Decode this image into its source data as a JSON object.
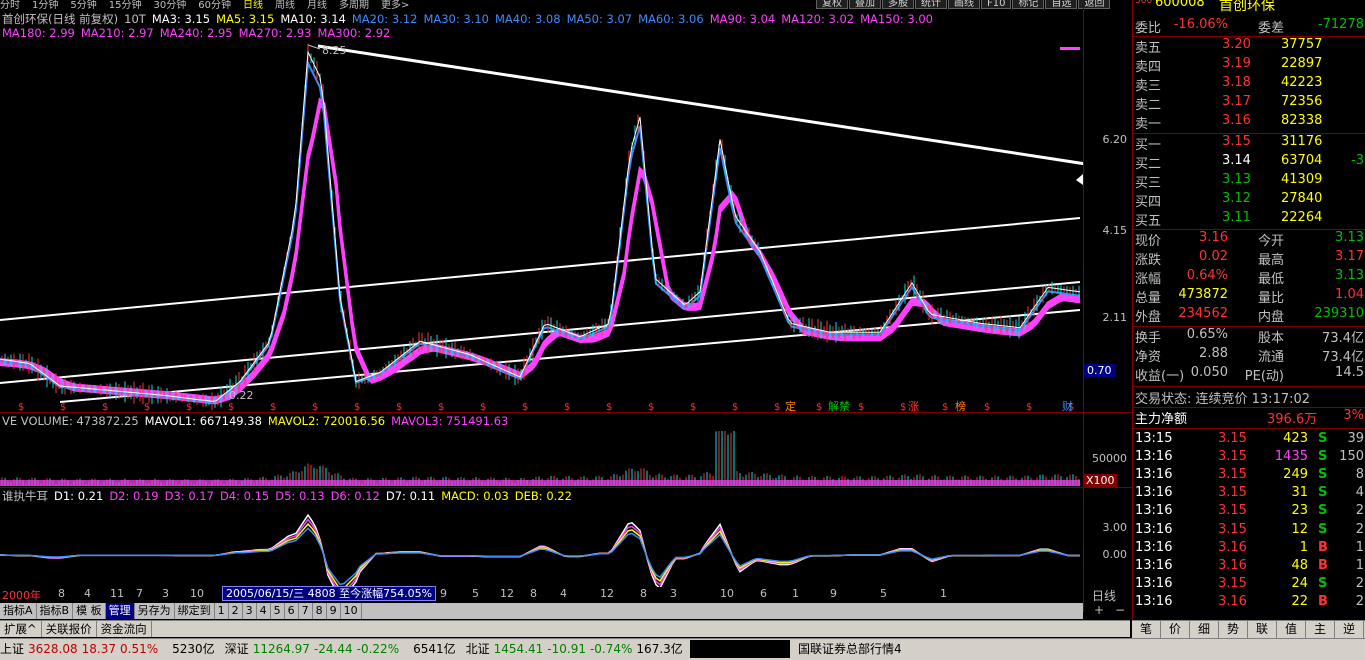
{
  "top_menu": [
    "分时",
    "1分钟",
    "5分钟",
    "15分钟",
    "30分钟",
    "60分钟",
    "日线",
    "周线",
    "月线",
    "多周期",
    "更多>"
  ],
  "top_buttons": [
    "复权",
    "叠加",
    "多股",
    "统计",
    "画线",
    "F10",
    "标记",
    "自选",
    "返回"
  ],
  "stock_header": {
    "code": "600008",
    "name": "首创环保",
    "flag": "500"
  },
  "chart_title": "首创环保(日线 前复权)",
  "ma_line1": [
    {
      "label": "10T",
      "color": "#c0c0c0"
    },
    {
      "label": "MA3: 3.15",
      "color": "#ffffff"
    },
    {
      "label": "MA5: 3.15",
      "color": "#ffff00"
    },
    {
      "label": "MA10: 3.14",
      "color": "#ffffff"
    },
    {
      "label": "MA20: 3.12",
      "color": "#3c8cff"
    },
    {
      "label": "MA30: 3.10",
      "color": "#3c8cff"
    },
    {
      "label": "MA40: 3.08",
      "color": "#3c8cff"
    },
    {
      "label": "MA50: 3.07",
      "color": "#3c8cff"
    },
    {
      "label": "MA60: 3.06",
      "color": "#3c8cff"
    },
    {
      "label": "MA90: 3.04",
      "color": "#ff40ff"
    },
    {
      "label": "MA120: 3.02",
      "color": "#ff40ff"
    },
    {
      "label": "MA150: 3.00",
      "color": "#ff40ff"
    }
  ],
  "ma_line2": [
    {
      "label": "MA180: 2.99",
      "color": "#ff40ff"
    },
    {
      "label": "MA210: 2.97",
      "color": "#ff40ff"
    },
    {
      "label": "MA240: 2.95",
      "color": "#ff40ff"
    },
    {
      "label": "MA270: 2.93",
      "color": "#ff40ff"
    },
    {
      "label": "MA300: 2.92",
      "color": "#ff40ff"
    }
  ],
  "price_axis": [
    "8.25",
    "6.20",
    "4.15",
    "2.11",
    "0.70"
  ],
  "high_marker": "8.25",
  "low_marker": "0.22",
  "event_tags": [
    "定",
    "解禁",
    "涨",
    "榜",
    "财"
  ],
  "volume_line": [
    {
      "label": "VE VOLUME: 473872.25",
      "color": "#c0c0c0"
    },
    {
      "label": "MAVOL1: 667149.38",
      "color": "#ffffff"
    },
    {
      "label": "MAVOL2: 720016.56",
      "color": "#ffff00"
    },
    {
      "label": "MAVOL3: 751491.63",
      "color": "#ff40ff"
    }
  ],
  "volume_axis": [
    "50000",
    "X100"
  ],
  "indicator_line": [
    {
      "label": "谁执牛耳",
      "color": "#c0c0c0"
    },
    {
      "label": "D1: 0.21",
      "color": "#ffffff"
    },
    {
      "label": "D2: 0.19",
      "color": "#ff40ff"
    },
    {
      "label": "D3: 0.17",
      "color": "#ff40ff"
    },
    {
      "label": "D4: 0.15",
      "color": "#ff40ff"
    },
    {
      "label": "D5: 0.13",
      "color": "#ff40ff"
    },
    {
      "label": "D6: 0.12",
      "color": "#ff40ff"
    },
    {
      "label": "D7: 0.11",
      "color": "#ffffff"
    },
    {
      "label": "MACD: 0.03",
      "color": "#ffff00"
    },
    {
      "label": "DEB: 0.22",
      "color": "#ffff00"
    }
  ],
  "indicator_axis": [
    "3.00",
    "0.00"
  ],
  "date_axis": {
    "start": "2000年",
    "ticks": [
      "8",
      "4",
      "11",
      "7",
      "3",
      "10",
      "9",
      "5",
      "12",
      "8",
      "4",
      "12",
      "8",
      "3",
      "10",
      "6",
      "1",
      "9",
      "5",
      "1"
    ],
    "highlight": "2005/06/15/三 4808 至今涨幅754.05%",
    "right_label": "日线",
    "plus": "+",
    "minus": "−"
  },
  "indicator_tabs": [
    "指标A",
    "指标B",
    "模 板",
    "管理",
    "另存为",
    "绑定到",
    "1",
    "2",
    "3",
    "4",
    "5",
    "6",
    "7",
    "8",
    "9",
    "10"
  ],
  "selected_tab": "管理",
  "bottom_tabs": [
    "扩展^",
    "关联报价",
    "资金流向"
  ],
  "order_book": {
    "ratio_label": "委比",
    "ratio": "-16.06%",
    "diff_label": "委差",
    "diff": "-71278",
    "asks": [
      {
        "label": "卖五",
        "price": "3.20",
        "vol": "37757"
      },
      {
        "label": "卖四",
        "price": "3.19",
        "vol": "22897"
      },
      {
        "label": "卖三",
        "price": "3.18",
        "vol": "42223"
      },
      {
        "label": "卖二",
        "price": "3.17",
        "vol": "72356"
      },
      {
        "label": "卖一",
        "price": "3.16",
        "vol": "82338"
      }
    ],
    "bids": [
      {
        "label": "买一",
        "price": "3.15",
        "vol": "31176",
        "extra": ""
      },
      {
        "label": "买二",
        "price": "3.14",
        "vol": "63704",
        "extra": "-3"
      },
      {
        "label": "买三",
        "price": "3.13",
        "vol": "41309",
        "extra": ""
      },
      {
        "label": "买四",
        "price": "3.12",
        "vol": "27840",
        "extra": ""
      },
      {
        "label": "买五",
        "price": "3.11",
        "vol": "22264",
        "extra": ""
      }
    ]
  },
  "quote": [
    {
      "l1": "现价",
      "v1": "3.16",
      "l2": "今开",
      "v2": "3.13",
      "c1": "#ff3232",
      "c2": "#00c000"
    },
    {
      "l1": "涨跌",
      "v1": "0.02",
      "l2": "最高",
      "v2": "3.17",
      "c1": "#ff3232",
      "c2": "#ff3232"
    },
    {
      "l1": "涨幅",
      "v1": "0.64%",
      "l2": "最低",
      "v2": "3.13",
      "c1": "#ff3232",
      "c2": "#00c000"
    },
    {
      "l1": "总量",
      "v1": "473872",
      "l2": "量比",
      "v2": "1.04",
      "c1": "#ffff00",
      "c2": "#ff3232"
    },
    {
      "l1": "外盘",
      "v1": "234562",
      "l2": "内盘",
      "v2": "239310",
      "c1": "#ff3232",
      "c2": "#00c000"
    }
  ],
  "quote2": [
    {
      "l1": "换手",
      "v1": "0.65%",
      "l2": "股本",
      "v2": "73.4亿"
    },
    {
      "l1": "净资",
      "v1": "2.88",
      "l2": "流通",
      "v2": "73.4亿"
    },
    {
      "l1": "收益(一)",
      "v1": "0.050",
      "l2": "PE(动)",
      "v2": "14.5"
    }
  ],
  "trade_status": "交易状态: 连续竞价 13:17:02",
  "main_flow": {
    "label": "主力净额",
    "value": "396.6万",
    "pct": "3%"
  },
  "ticks": [
    {
      "t": "13:15",
      "p": "3.15",
      "v": "423",
      "bs": "S",
      "n": "39",
      "pc": "#ff3232",
      "vc": "#ffff00",
      "bc": "#00c000"
    },
    {
      "t": "13:16",
      "p": "3.15",
      "v": "1435",
      "bs": "S",
      "n": "150",
      "pc": "#ff3232",
      "vc": "#ff40ff",
      "bc": "#00c000"
    },
    {
      "t": "13:16",
      "p": "3.15",
      "v": "249",
      "bs": "S",
      "n": "8",
      "pc": "#ff3232",
      "vc": "#ffff00",
      "bc": "#00c000"
    },
    {
      "t": "13:16",
      "p": "3.15",
      "v": "31",
      "bs": "S",
      "n": "4",
      "pc": "#ff3232",
      "vc": "#ffff00",
      "bc": "#00c000"
    },
    {
      "t": "13:16",
      "p": "3.15",
      "v": "23",
      "bs": "S",
      "n": "2",
      "pc": "#ff3232",
      "vc": "#ffff00",
      "bc": "#00c000"
    },
    {
      "t": "13:16",
      "p": "3.15",
      "v": "12",
      "bs": "S",
      "n": "2",
      "pc": "#ff3232",
      "vc": "#ffff00",
      "bc": "#00c000"
    },
    {
      "t": "13:16",
      "p": "3.16",
      "v": "1",
      "bs": "B",
      "n": "1",
      "pc": "#ff3232",
      "vc": "#ffff00",
      "bc": "#ff3232"
    },
    {
      "t": "13:16",
      "p": "3.16",
      "v": "48",
      "bs": "B",
      "n": "1",
      "pc": "#ff3232",
      "vc": "#ffff00",
      "bc": "#ff3232"
    },
    {
      "t": "13:16",
      "p": "3.15",
      "v": "24",
      "bs": "S",
      "n": "2",
      "pc": "#ff3232",
      "vc": "#ffff00",
      "bc": "#00c000"
    },
    {
      "t": "13:16",
      "p": "3.16",
      "v": "22",
      "bs": "B",
      "n": "2",
      "pc": "#ff3232",
      "vc": "#ffff00",
      "bc": "#ff3232"
    }
  ],
  "right_tabs": [
    "笔",
    "价",
    "细",
    "势",
    "联",
    "值",
    "主",
    "逆",
    "筹"
  ],
  "status_bar": [
    {
      "text": "上证",
      "color": "#000000"
    },
    {
      "text": "3628.08",
      "color": "#c00000"
    },
    {
      "text": "18.37",
      "color": "#c00000"
    },
    {
      "text": "0.51%",
      "color": "#c00000"
    },
    {
      "text": "5230亿",
      "color": "#000000"
    },
    {
      "text": "深证",
      "color": "#000000"
    },
    {
      "text": "11264.97",
      "color": "#008000"
    },
    {
      "text": "-24.44",
      "color": "#008000"
    },
    {
      "text": "-0.22%",
      "color": "#008000"
    },
    {
      "text": "6541亿",
      "color": "#000000"
    },
    {
      "text": "北证",
      "color": "#000000"
    },
    {
      "text": "1454.41",
      "color": "#008000"
    },
    {
      "text": "-10.91",
      "color": "#008000"
    },
    {
      "text": "-0.74%",
      "color": "#008000"
    },
    {
      "text": "167.3亿",
      "color": "#000000"
    }
  ],
  "status_right": "国联证券总部行情4",
  "colors": {
    "up": "#ff3232",
    "down": "#00c000",
    "ma_short": "#ffffff",
    "ma_mid": "#3c8cff",
    "ma_long": "#ff40ff",
    "panel_border": "#800000"
  }
}
